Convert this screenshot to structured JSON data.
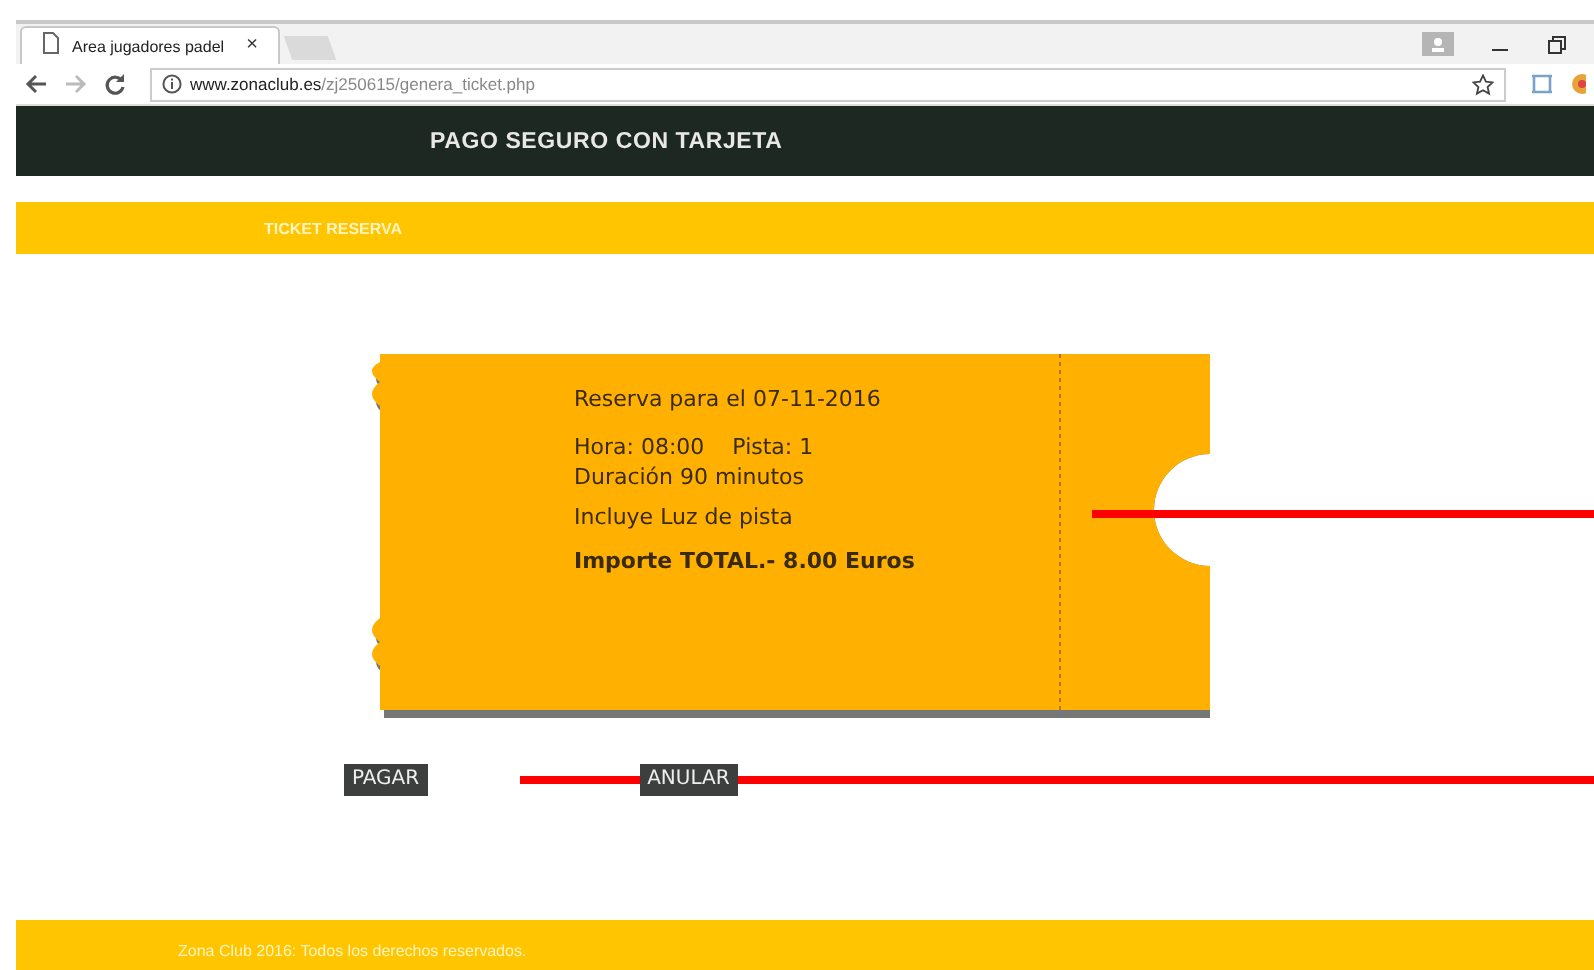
{
  "browser": {
    "tab_title": "Area jugadores padel",
    "tab_close": "×",
    "url_host": "www.zonaclub.es",
    "url_path": "/zj250615/genera_ticket.php"
  },
  "header": {
    "title": "PAGO SEGURO CON TARJETA"
  },
  "section_bar": {
    "label": "TICKET RESERVA"
  },
  "ticket": {
    "lines": [
      {
        "kind": "plain",
        "text": "Reserva para el 07-11-2016"
      },
      {
        "kind": "pair",
        "text": "Hora: 08:00",
        "text2": "Pista: 1"
      },
      {
        "kind": "plain",
        "text": "Duración 90 minutos"
      },
      {
        "kind": "plain",
        "text": "Incluye Luz de pista"
      },
      {
        "kind": "total",
        "text": "Importe TOTAL.- 8.00 Euros"
      }
    ]
  },
  "buttons": [
    "PAGAR",
    "ANULAR"
  ],
  "footer": {
    "text": "Zona Club 2016: Todos los derechos reservados."
  }
}
